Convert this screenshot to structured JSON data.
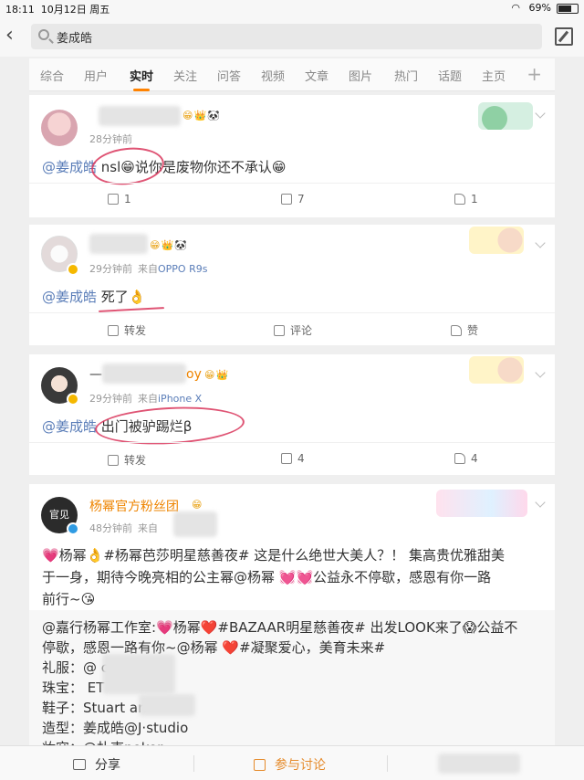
{
  "status_bar": {
    "time": "18:11",
    "date": "10月12日 周五",
    "battery": "69%"
  },
  "search": {
    "query": "姜成皓"
  },
  "tabs": [
    "综合",
    "用户",
    "实时",
    "关注",
    "问答",
    "视频",
    "文章",
    "图片",
    "热门",
    "话题",
    "主页"
  ],
  "active_tab": "实时",
  "posts": [
    {
      "time": "28分钟前",
      "mention": "@姜成皓",
      "text": "nsl😁说你是废物你还不承认😁",
      "actions": {
        "repost": "1",
        "comment": "7",
        "like": "1"
      }
    },
    {
      "time": "29分钟前",
      "source_prefix": "来自",
      "source": "OPPO R9s",
      "mention": "@姜成皓",
      "text": "死了👌",
      "actions": {
        "repost": "转发",
        "comment": "评论",
        "like": "赞"
      }
    },
    {
      "name_suffix": "oy",
      "time": "29分钟前",
      "source_prefix": "来自",
      "source": "iPhone X",
      "mention": "@姜成皓",
      "text": "出门被驴踢烂β",
      "actions": {
        "repost": "转发",
        "comment": "4",
        "like": "4"
      }
    },
    {
      "name": "杨幂官方粉丝团",
      "time": "48分钟前",
      "source_prefix": "来自",
      "avatar_text": "官见",
      "lines": [
        "💗杨幂👌#杨幂芭莎明星慈善夜# 这是什么绝世大美人？！ 集高贵优雅甜美",
        "于一身，期待今晚亮相的公主幂@杨幂  💓💓公益永不停歇，感恩有你一路",
        "前行~😘"
      ],
      "repost_lines": [
        "@嘉行杨幂工作室:💗杨幂❤️#BAZAAR明星慈善夜# 出发LOOK来了😱公益不",
        "停歇，感恩一路有你~@杨幂 ❤️#凝聚爱心，美育未来#",
        "礼服：@        cra",
        "珠宝：          ET",
        "鞋子：Stuart        an",
        "造型：姜成皓@J·studio",
        "妆容：@扑克poker"
      ]
    }
  ],
  "bottom_bar": {
    "share": "分享",
    "discuss": "参与讨论"
  },
  "colors": {
    "accent": "#ff8200",
    "link": "#5a7db8",
    "name_orange": "#ee8400",
    "annotation_red": "#d9365c"
  }
}
